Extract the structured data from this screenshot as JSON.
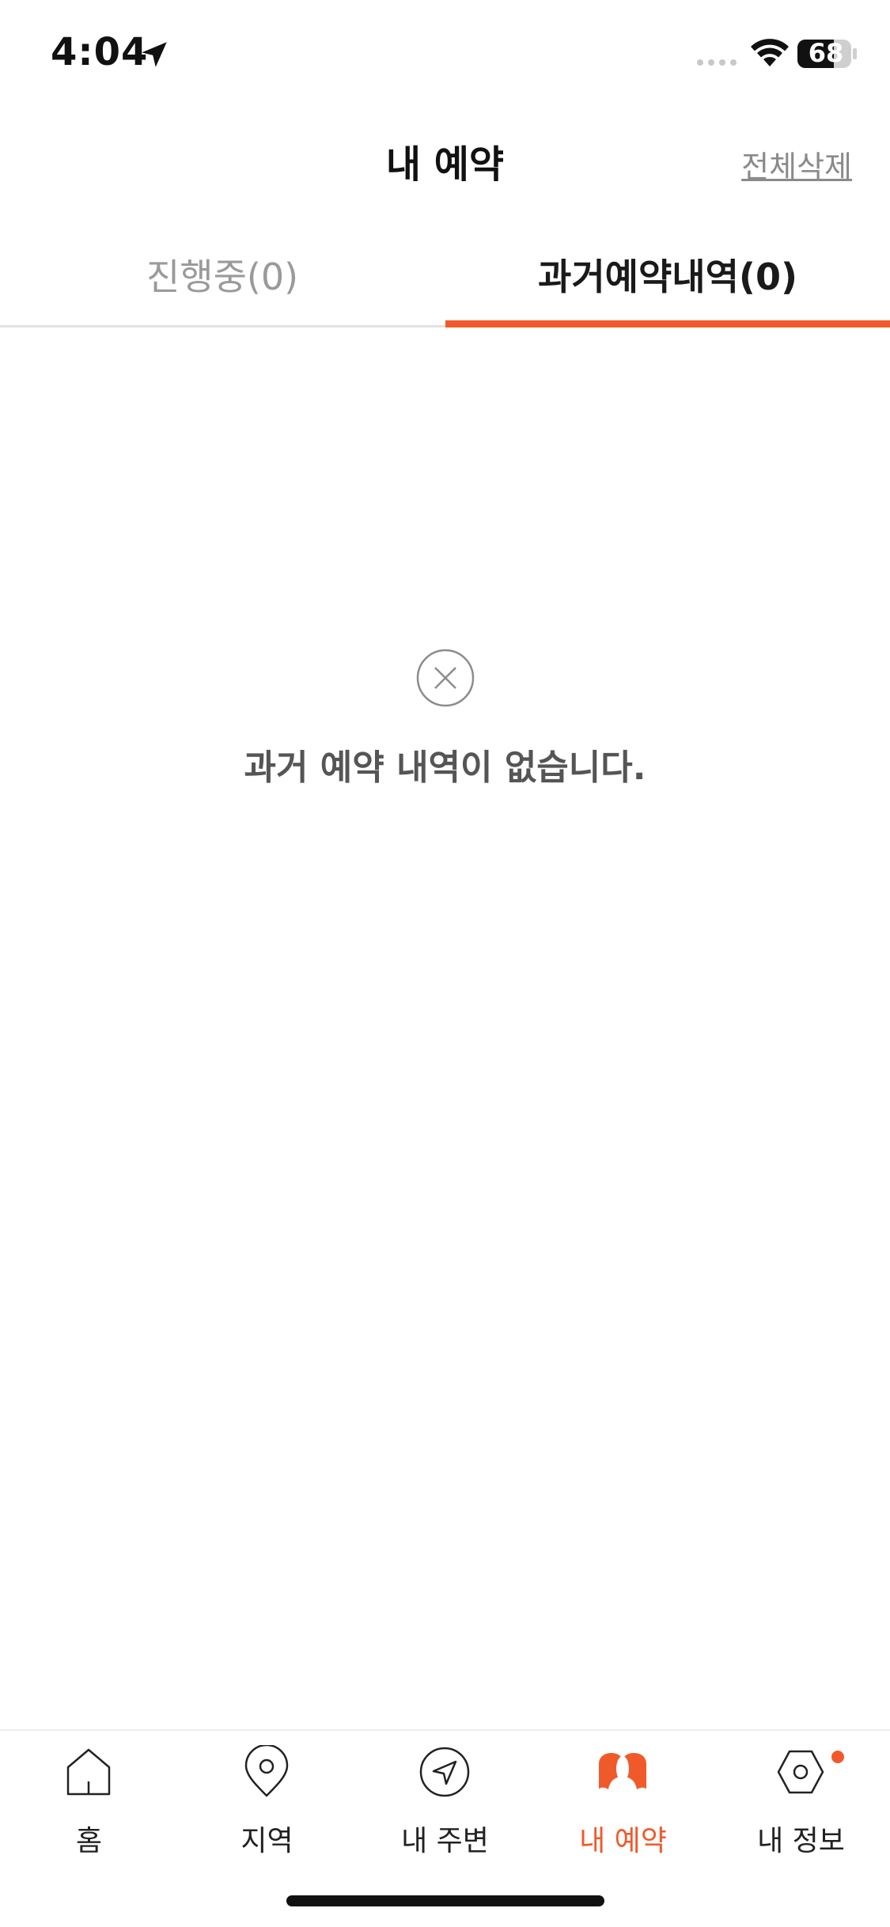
{
  "status_bar": {
    "time": "4:04",
    "battery": "68"
  },
  "header": {
    "title": "내 예약",
    "delete_all_label": "전체삭제"
  },
  "tabs": [
    {
      "label": "진행중(0)",
      "active": false
    },
    {
      "label": "과거예약내역(0)",
      "active": true
    }
  ],
  "empty_state": {
    "icon": "close-circle-icon",
    "message": "과거 예약 내역이 없습니다."
  },
  "bottom_nav": {
    "items": [
      {
        "label": "홈",
        "icon": "home-icon",
        "active": false
      },
      {
        "label": "지역",
        "icon": "map-pin-icon",
        "active": false
      },
      {
        "label": "내 주변",
        "icon": "navigation-icon",
        "active": false
      },
      {
        "label": "내 예약",
        "icon": "reservation-icon",
        "active": true
      },
      {
        "label": "내 정보",
        "icon": "hexagon-icon",
        "active": false,
        "badge": true
      }
    ]
  },
  "colors": {
    "accent": "#f05a2b",
    "inactive_tab": "#9a9a9a",
    "divider": "#e2e2e2"
  }
}
